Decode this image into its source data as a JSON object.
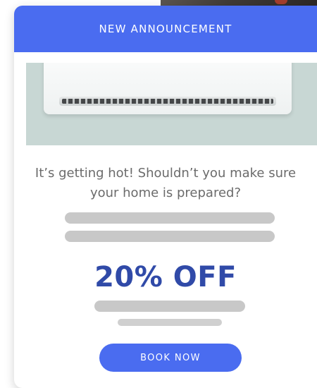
{
  "announcement": {
    "header_title": "NEW ANNOUNCEMENT",
    "message": "It’s getting hot! Shouldn’t you make sure your home is prepared?",
    "discount": "20% OFF",
    "cta_label": "BOOK NOW"
  },
  "colors": {
    "primary": "#4a6cf0",
    "discount_text": "#304aa8",
    "placeholder_bar": "#c8c8c8",
    "body_text": "#6b6b6b"
  },
  "images": {
    "hero": "air-conditioner-unit"
  }
}
